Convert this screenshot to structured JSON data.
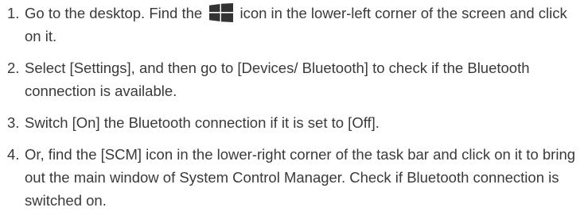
{
  "steps": [
    {
      "number": "1.",
      "text_before_icon": "Go to the desktop. Find the",
      "icon": "windows-start-icon",
      "text_after_icon": "icon in the lower-left corner of the screen and click on it."
    },
    {
      "number": "2.",
      "text": "Select [Settings], and then go to [Devices/ Bluetooth] to check if the Bluetooth connection is available."
    },
    {
      "number": "3.",
      "text": "Switch [On] the Bluetooth connection if it is set to [Off]."
    },
    {
      "number": "4.",
      "text": "Or, find the [SCM] icon in the lower-right corner of the task bar and click on it to bring out the main window of System Control Manager.  Check if Bluetooth connection is switched on."
    }
  ],
  "colors": {
    "text": "#3a3a3a",
    "icon": "#333333"
  }
}
